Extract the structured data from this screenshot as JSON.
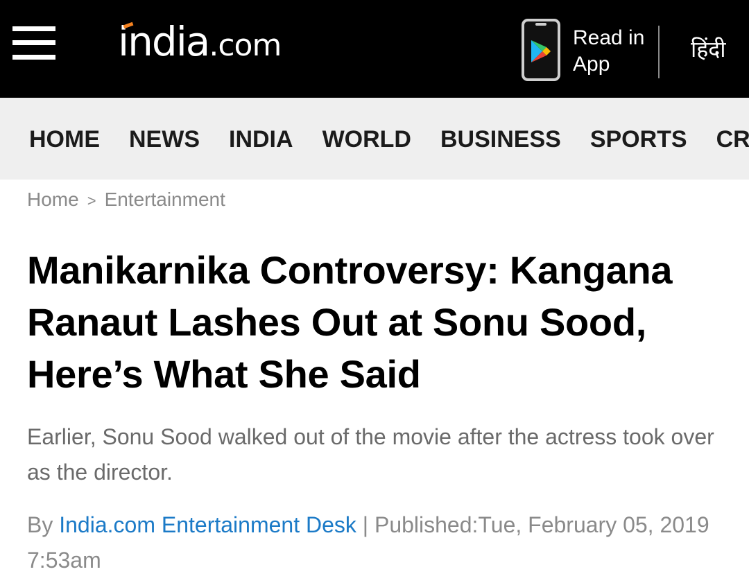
{
  "header": {
    "logo_brand": "india",
    "logo_tld": ".com",
    "read_app_line1": "Read in",
    "read_app_line2": "App",
    "hindi_label": "हिंदी",
    "accent_color": "#f58220"
  },
  "nav": {
    "items": [
      "HOME",
      "NEWS",
      "INDIA",
      "WORLD",
      "BUSINESS",
      "SPORTS",
      "CRIC"
    ]
  },
  "breadcrumb": {
    "home": "Home",
    "separator": ">",
    "section": "Entertainment"
  },
  "article": {
    "headline": "Manikarnika Controversy: Kangana Ranaut Lashes Out at Sonu Sood, Here’s What She Said",
    "summary": "Earlier, Sonu Sood walked out of the movie after the actress took over as the director.",
    "by_prefix": "By ",
    "author": "India.com Entertainment Desk",
    "published": " | Published:Tue, February 05, 2019 7:53am"
  },
  "colors": {
    "topbar": "#000000",
    "navbar": "#efefef",
    "author_link": "#1b7ac7"
  }
}
